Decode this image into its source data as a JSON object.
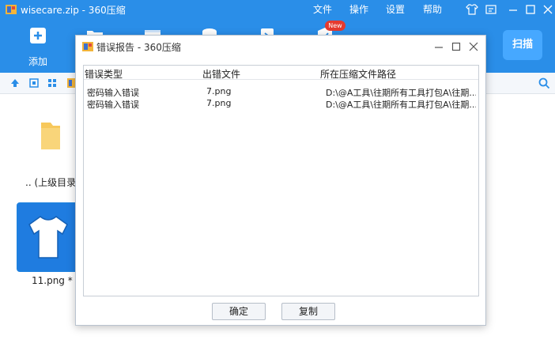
{
  "window": {
    "title": "wisecare.zip - 360压缩",
    "menu": [
      "文件",
      "操作",
      "设置",
      "帮助"
    ]
  },
  "toolbar": {
    "add_label": "添加",
    "new_badge": "New",
    "scan_label": "扫描"
  },
  "files": {
    "parent_label": ".. (上级目录)",
    "file_label": "11.png *"
  },
  "dialog": {
    "title": "错误报告 - 360压缩",
    "columns": [
      "错误类型",
      "出错文件",
      "所在压缩文件路径"
    ],
    "rows": [
      [
        "密码输入错误",
        "7.png",
        "D:\\@A工具\\往期所有工具打包A\\往期..."
      ],
      [
        "密码输入错误",
        "7.png",
        "D:\\@A工具\\往期所有工具打包A\\往期..."
      ]
    ],
    "ok_label": "确定",
    "copy_label": "复制"
  },
  "colors": {
    "accent": "#2a8ee8",
    "folder": "#f7c85b"
  }
}
